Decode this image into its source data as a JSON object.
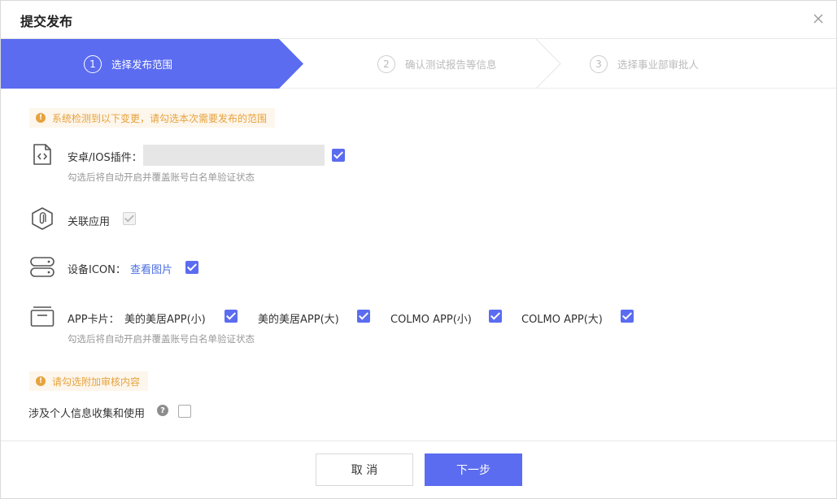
{
  "dialog": {
    "title": "提交发布"
  },
  "steps": [
    {
      "num": "1",
      "label": "选择发布范围"
    },
    {
      "num": "2",
      "label": "确认测试报告等信息"
    },
    {
      "num": "3",
      "label": "选择事业部审批人"
    }
  ],
  "notice_change": {
    "text": "系统检测到以下变更，请勾选本次需要发布的范围",
    "icon": "warning-icon"
  },
  "plugin": {
    "label": "安卓/IOS插件：",
    "hint": "勾选后将自动开启并覆盖账号白名单验证状态",
    "checked": true,
    "icon": "code-file-icon"
  },
  "related_app": {
    "label": "关联应用",
    "checked": true,
    "disabled": true,
    "icon": "attachment-hex-icon"
  },
  "device_icon": {
    "label": "设备ICON：",
    "link": "查看图片",
    "checked": true,
    "icon": "server-icon"
  },
  "app_card": {
    "label": "APP卡片：",
    "hint": "勾选后将自动开启并覆盖账号白名单验证状态",
    "icon": "card-box-icon",
    "options": [
      {
        "label": "美的美居APP(小)",
        "checked": true
      },
      {
        "label": "美的美居APP(大)",
        "checked": true
      },
      {
        "label": "COLMO APP(小)",
        "checked": true
      },
      {
        "label": "COLMO APP(大)",
        "checked": true
      }
    ]
  },
  "notice_extra": {
    "text": "请勾选附加审核内容",
    "icon": "warning-icon"
  },
  "privacy": {
    "label": "涉及个人信息收集和使用",
    "checked": false,
    "help_icon": "question-icon"
  },
  "footer": {
    "cancel_label": "取 消",
    "next_label": "下一步"
  },
  "colors": {
    "accent": "#5b6cf0",
    "warning": "#e6a23c",
    "link": "#4a6ee0"
  }
}
